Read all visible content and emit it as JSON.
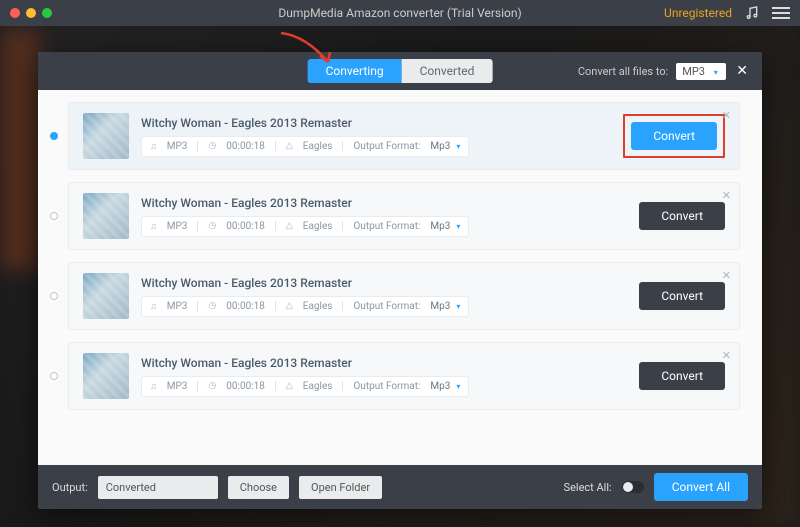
{
  "titlebar": {
    "title": "DumpMedia Amazon converter (Trial Version)",
    "status": "Unregistered"
  },
  "header": {
    "tabs": {
      "converting": "Converting",
      "converted": "Converted"
    },
    "convert_all_label": "Convert all files to:",
    "main_format": "MP3"
  },
  "tracks": [
    {
      "title": "Witchy Woman - Eagles 2013 Remaster",
      "format": "MP3",
      "duration": "00:00:18",
      "artist": "Eagles",
      "output_label": "Output Format:",
      "output_value": "Mp3",
      "button": "Convert",
      "primary": true,
      "selected": true
    },
    {
      "title": "Witchy Woman - Eagles 2013 Remaster",
      "format": "MP3",
      "duration": "00:00:18",
      "artist": "Eagles",
      "output_label": "Output Format:",
      "output_value": "Mp3",
      "button": "Convert",
      "primary": false,
      "selected": false
    },
    {
      "title": "Witchy Woman - Eagles 2013 Remaster",
      "format": "MP3",
      "duration": "00:00:18",
      "artist": "Eagles",
      "output_label": "Output Format:",
      "output_value": "Mp3",
      "button": "Convert",
      "primary": false,
      "selected": false
    },
    {
      "title": "Witchy Woman - Eagles 2013 Remaster",
      "format": "MP3",
      "duration": "00:00:18",
      "artist": "Eagles",
      "output_label": "Output Format:",
      "output_value": "Mp3",
      "button": "Convert",
      "primary": false,
      "selected": false
    }
  ],
  "footer": {
    "output_label": "Output:",
    "output_value": "Converted",
    "choose": "Choose",
    "open_folder": "Open Folder",
    "select_all": "Select All:",
    "convert_all": "Convert All"
  }
}
